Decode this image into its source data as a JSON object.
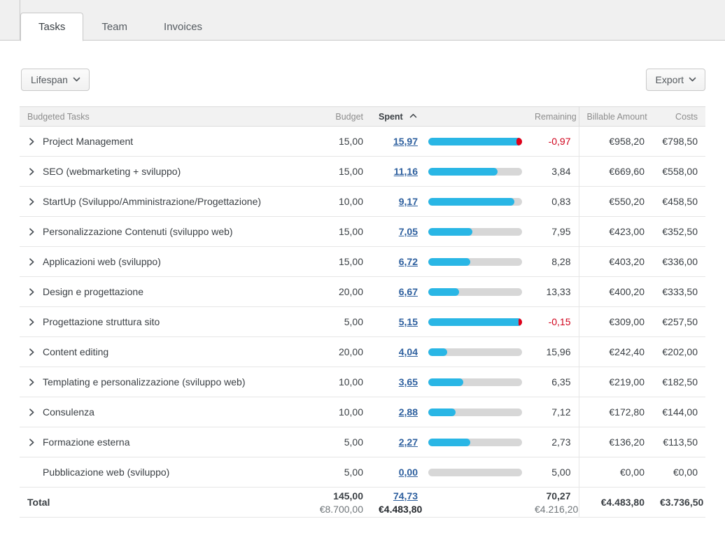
{
  "tabs": [
    {
      "label": "Tasks",
      "active": true
    },
    {
      "label": "Team",
      "active": false
    },
    {
      "label": "Invoices",
      "active": false
    }
  ],
  "toolbar": {
    "lifespan_label": "Lifespan",
    "export_label": "Export"
  },
  "colors": {
    "progress_fill": "#29b6e5",
    "progress_over": "#e2001a",
    "progress_track": "#d7d7d7",
    "link": "#2d5f9e",
    "negative": "#d0021b"
  },
  "table": {
    "columns": [
      {
        "key": "task",
        "label": "Budgeted Tasks",
        "align": "left"
      },
      {
        "key": "budget",
        "label": "Budget",
        "align": "right"
      },
      {
        "key": "spent",
        "label": "Spent",
        "align": "left",
        "sorted": "asc",
        "sort_icon": "chevron-up-icon"
      },
      {
        "key": "bar",
        "label": "",
        "align": "left"
      },
      {
        "key": "remaining",
        "label": "Remaining",
        "align": "right"
      },
      {
        "key": "billable",
        "label": "Billable Amount",
        "align": "right"
      },
      {
        "key": "costs",
        "label": "Costs",
        "align": "right"
      }
    ],
    "rows": [
      {
        "expandable": true,
        "task": "Project Management",
        "budget": "15,00",
        "spent": "15,97",
        "pct": 100,
        "over_pct": 6,
        "remaining": "-0,97",
        "remaining_negative": true,
        "billable": "€958,20",
        "costs": "€798,50"
      },
      {
        "expandable": true,
        "task": "SEO (webmarketing + sviluppo)",
        "budget": "15,00",
        "spent": "11,16",
        "pct": 74,
        "over_pct": 0,
        "remaining": "3,84",
        "remaining_negative": false,
        "billable": "€669,60",
        "costs": "€558,00"
      },
      {
        "expandable": true,
        "task": "StartUp (Sviluppo/Amministrazione/Progettazione)",
        "budget": "10,00",
        "spent": "9,17",
        "pct": 92,
        "over_pct": 0,
        "remaining": "0,83",
        "remaining_negative": false,
        "billable": "€550,20",
        "costs": "€458,50"
      },
      {
        "expandable": true,
        "task": "Personalizzazione Contenuti (sviluppo web)",
        "budget": "15,00",
        "spent": "7,05",
        "pct": 47,
        "over_pct": 0,
        "remaining": "7,95",
        "remaining_negative": false,
        "billable": "€423,00",
        "costs": "€352,50"
      },
      {
        "expandable": true,
        "task": "Applicazioni web (sviluppo)",
        "budget": "15,00",
        "spent": "6,72",
        "pct": 45,
        "over_pct": 0,
        "remaining": "8,28",
        "remaining_negative": false,
        "billable": "€403,20",
        "costs": "€336,00"
      },
      {
        "expandable": true,
        "task": "Design e progettazione",
        "budget": "20,00",
        "spent": "6,67",
        "pct": 33,
        "over_pct": 0,
        "remaining": "13,33",
        "remaining_negative": false,
        "billable": "€400,20",
        "costs": "€333,50"
      },
      {
        "expandable": true,
        "task": "Progettazione struttura sito",
        "budget": "5,00",
        "spent": "5,15",
        "pct": 100,
        "over_pct": 4,
        "remaining": "-0,15",
        "remaining_negative": true,
        "billable": "€309,00",
        "costs": "€257,50"
      },
      {
        "expandable": true,
        "task": "Content editing",
        "budget": "20,00",
        "spent": "4,04",
        "pct": 20,
        "over_pct": 0,
        "remaining": "15,96",
        "remaining_negative": false,
        "billable": "€242,40",
        "costs": "€202,00"
      },
      {
        "expandable": true,
        "task": "Templating e personalizzazione (sviluppo web)",
        "budget": "10,00",
        "spent": "3,65",
        "pct": 37,
        "over_pct": 0,
        "remaining": "6,35",
        "remaining_negative": false,
        "billable": "€219,00",
        "costs": "€182,50"
      },
      {
        "expandable": true,
        "task": "Consulenza",
        "budget": "10,00",
        "spent": "2,88",
        "pct": 29,
        "over_pct": 0,
        "remaining": "7,12",
        "remaining_negative": false,
        "billable": "€172,80",
        "costs": "€144,00"
      },
      {
        "expandable": true,
        "task": "Formazione esterna",
        "budget": "5,00",
        "spent": "2,27",
        "pct": 45,
        "over_pct": 0,
        "remaining": "2,73",
        "remaining_negative": false,
        "billable": "€136,20",
        "costs": "€113,50"
      },
      {
        "expandable": false,
        "task": "Pubblicazione web (sviluppo)",
        "budget": "5,00",
        "spent": "0,00",
        "pct": 0,
        "over_pct": 0,
        "remaining": "5,00",
        "remaining_negative": false,
        "billable": "€0,00",
        "costs": "€0,00"
      }
    ],
    "total": {
      "label": "Total",
      "budget": "145,00",
      "budget_amount": "€8.700,00",
      "spent": "74,73",
      "spent_amount": "€4.483,80",
      "remaining": "70,27",
      "remaining_amount": "€4.216,20",
      "billable": "€4.483,80",
      "costs": "€3.736,50"
    }
  }
}
